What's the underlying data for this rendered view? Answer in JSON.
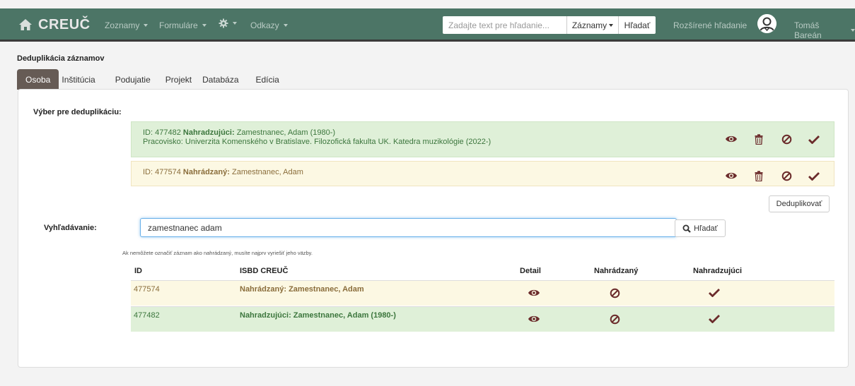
{
  "navbar": {
    "brand": "CREUČ",
    "menu": [
      {
        "label": "Zoznamy"
      },
      {
        "label": "Formuláre"
      },
      {
        "label": "Odkazy"
      }
    ],
    "search_placeholder": "Zadajte text pre hľadanie...",
    "search_scope": "Záznamy",
    "search_button": "Hľadať",
    "advanced_search": "Rozšírené hľadanie",
    "user_name": "Tomáš Bareán"
  },
  "page": {
    "title": "Deduplikácia záznamov",
    "tabs": [
      "Osoba",
      "Inštitúcia",
      "Podujatie",
      "Projekt",
      "Databáza",
      "Edícia"
    ],
    "active_tab": "Osoba"
  },
  "selection": {
    "label": "Výber pre deduplikáciu:",
    "replacing": {
      "id_text": "ID: 477482",
      "role": "Nahradzujúci:",
      "name": "Zamestnanec, Adam (1980-)",
      "workplace": "Pracovisko: Univerzita Komenského v Bratislave. Filozofická fakulta UK. Katedra muzikológie (2022-)"
    },
    "replaced": {
      "id_text": "ID: 477574",
      "role": "Nahrádzaný:",
      "name": "Zamestnanec, Adam"
    },
    "dedup_button": "Deduplikovať"
  },
  "search": {
    "label": "Vyhľadávanie:",
    "value": "zamestnanec adam",
    "button": "Hľadať",
    "note": "Ak nemôžete označiť záznam ako nahrádzaný, musíte najprv vyriešiť jeho väzby."
  },
  "table": {
    "headers": [
      "ID",
      "ISBD CREUČ",
      "Detail",
      "Nahrádzaný",
      "Nahradzujúci"
    ],
    "rows": [
      {
        "id": "477574",
        "isbd": "Nahrádzaný: Zamestnanec, Adam",
        "status": "replaced"
      },
      {
        "id": "477482",
        "isbd": "Nahradzujúci: Zamestnanec, Adam (1980-)",
        "status": "replacing"
      }
    ]
  },
  "colors": {
    "navbar": "#4c7566",
    "success_bg": "#dff0d8",
    "warning_bg": "#fcf8e3",
    "icon": "#6b2b2b"
  }
}
